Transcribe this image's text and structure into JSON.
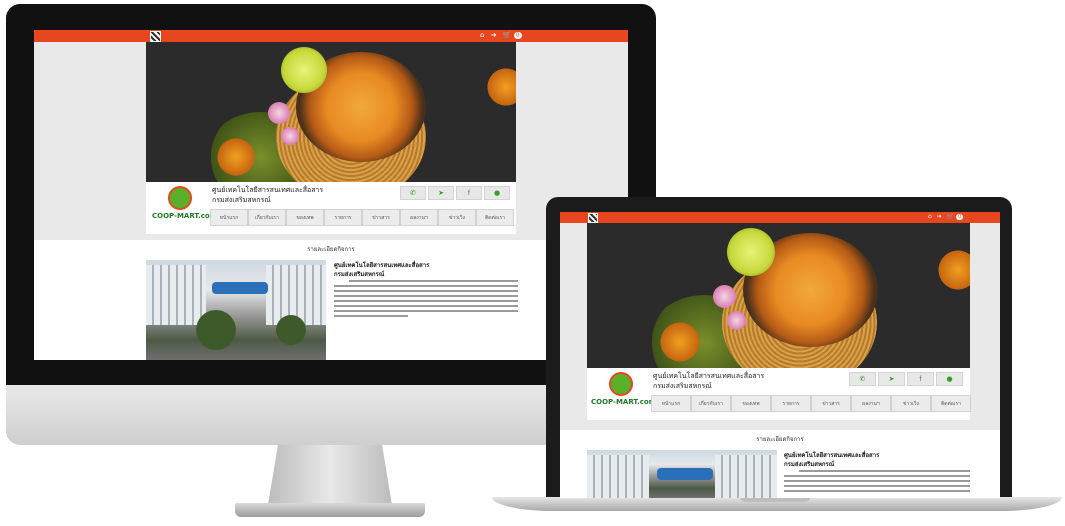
{
  "site": {
    "org_line1": "ศูนย์เทคโนโลยีสารสนเทศและสื่อสาร",
    "org_line2": "กรมส่งเสริมสหกรณ์",
    "logo_text": "COOP-MART.com",
    "nav": [
      "หน้าแรก",
      "เกี่ยวกับเรา",
      "ของเทพ",
      "รายการ",
      "ข่าวสาร",
      "ผลงานฯ",
      "ข่าวเวิ่ง",
      "ติดต่อเรา"
    ],
    "contact_icons": [
      "phone-icon",
      "location-icon",
      "facebook-icon",
      "line-icon"
    ],
    "section_title": "รายละเอียดกิจการ",
    "content_heading1": "ศูนย์เทคโนโลยีสารสนเทศและสื่อสาร",
    "content_heading2": "กรมส่งเสริมสหกรณ์",
    "cart_count": "0"
  },
  "colors": {
    "brand": "#e8461e",
    "accent_green": "#3d9a2d"
  }
}
